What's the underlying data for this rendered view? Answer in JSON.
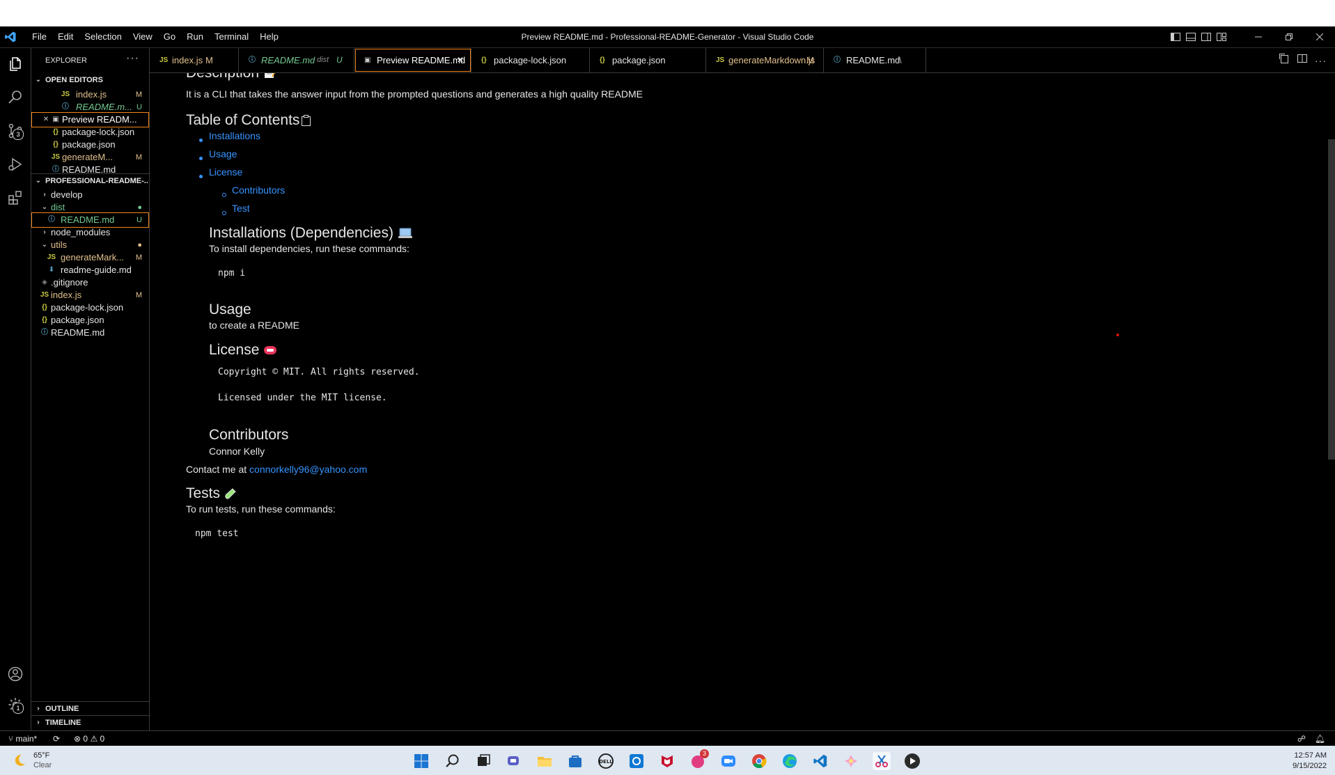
{
  "titlebar": {
    "menu": [
      "File",
      "Edit",
      "Selection",
      "View",
      "Go",
      "Run",
      "Terminal",
      "Help"
    ],
    "window_title": "Preview README.md - Professional-README-Generator - Visual Studio Code"
  },
  "activity": {
    "scm_badge": "3",
    "settings_badge": "1"
  },
  "sidebar": {
    "title": "EXPLORER",
    "more": "···",
    "open_editors_label": "OPEN EDITORS",
    "open_editors": [
      {
        "icon": "JS",
        "name": "index.js",
        "status": "M"
      },
      {
        "icon": "ⓘ",
        "name": "README.m...",
        "status": "U"
      },
      {
        "icon": "▣",
        "name": "Preview READM...",
        "status": ""
      },
      {
        "icon": "{}",
        "name": "package-lock.json",
        "status": ""
      },
      {
        "icon": "{}",
        "name": "package.json",
        "status": ""
      },
      {
        "icon": "JS",
        "name": "generateM...",
        "status": "M"
      },
      {
        "icon": "ⓘ",
        "name": "README.md",
        "status": ""
      }
    ],
    "project_label": "PROFESSIONAL-README-...",
    "tree": [
      {
        "icon": "›",
        "name": "develop",
        "status": ""
      },
      {
        "icon": "⌄",
        "name": "dist",
        "status": "●"
      },
      {
        "icon": "ⓘ",
        "name": "README.md",
        "status": "U"
      },
      {
        "icon": "›",
        "name": "node_modules",
        "status": ""
      },
      {
        "icon": "⌄",
        "name": "utils",
        "status": "●"
      },
      {
        "icon": "JS",
        "name": "generateMark...",
        "status": "M"
      },
      {
        "icon": "⬇",
        "name": "readme-guide.md",
        "status": ""
      },
      {
        "icon": "◈",
        "name": ".gitignore",
        "status": ""
      },
      {
        "icon": "JS",
        "name": "index.js",
        "status": "M"
      },
      {
        "icon": "{}",
        "name": "package-lock.json",
        "status": ""
      },
      {
        "icon": "{}",
        "name": "package.json",
        "status": ""
      },
      {
        "icon": "ⓘ",
        "name": "README.md",
        "status": ""
      }
    ],
    "outline_label": "OUTLINE",
    "timeline_label": "TIMELINE"
  },
  "tabs": [
    {
      "icon": "JS",
      "label": "index.js",
      "status": "M"
    },
    {
      "icon": "ⓘ",
      "label": "README.md",
      "extra": "dist",
      "status": "U"
    },
    {
      "icon": "▣",
      "label": "Preview README.md",
      "close": "✕"
    },
    {
      "icon": "{}",
      "label": "package-lock.json"
    },
    {
      "icon": "{}",
      "label": "package.json"
    },
    {
      "icon": "JS",
      "label": "generateMarkdown.js",
      "status": "M"
    },
    {
      "icon": "ⓘ",
      "label": "README.md",
      "status": "\\"
    }
  ],
  "preview": {
    "description_heading": "Description",
    "description_text": "It is a CLI that takes the answer input from the prompted questions and generates a high quality README",
    "toc_heading": "Table of Contents",
    "toc": [
      "Installations",
      "Usage",
      "License"
    ],
    "toc_sub": [
      "Contributors",
      "Test"
    ],
    "install_heading": "Installations (Dependencies)",
    "install_text": "To install dependencies, run these commands:",
    "install_code": "npm i",
    "usage_heading": "Usage",
    "usage_text": "to create a README",
    "license_heading": "License",
    "license_line1": "Copyright © MIT. All rights reserved.",
    "license_line2": "Licensed under the MIT license.",
    "contrib_heading": "Contributors",
    "contrib_name": "Connor Kelly",
    "contact_prefix": "Contact me at",
    "contact_email": "connorkelly96@yahoo.com",
    "tests_heading": "Tests",
    "tests_text": "To run tests, run these commands:",
    "tests_code": "npm test"
  },
  "statusbar": {
    "branch": "main*",
    "errors": "0",
    "warnings": "0"
  },
  "taskbar": {
    "temp": "65°F",
    "condition": "Clear",
    "time": "12:57 AM",
    "date": "9/15/2022",
    "notif_badge": "3"
  },
  "colors": {
    "accent_outline": "#f38518",
    "link": "#3794ff",
    "modified": "#e2c08d",
    "untracked": "#73c991",
    "js_icon": "#cbcb41"
  }
}
